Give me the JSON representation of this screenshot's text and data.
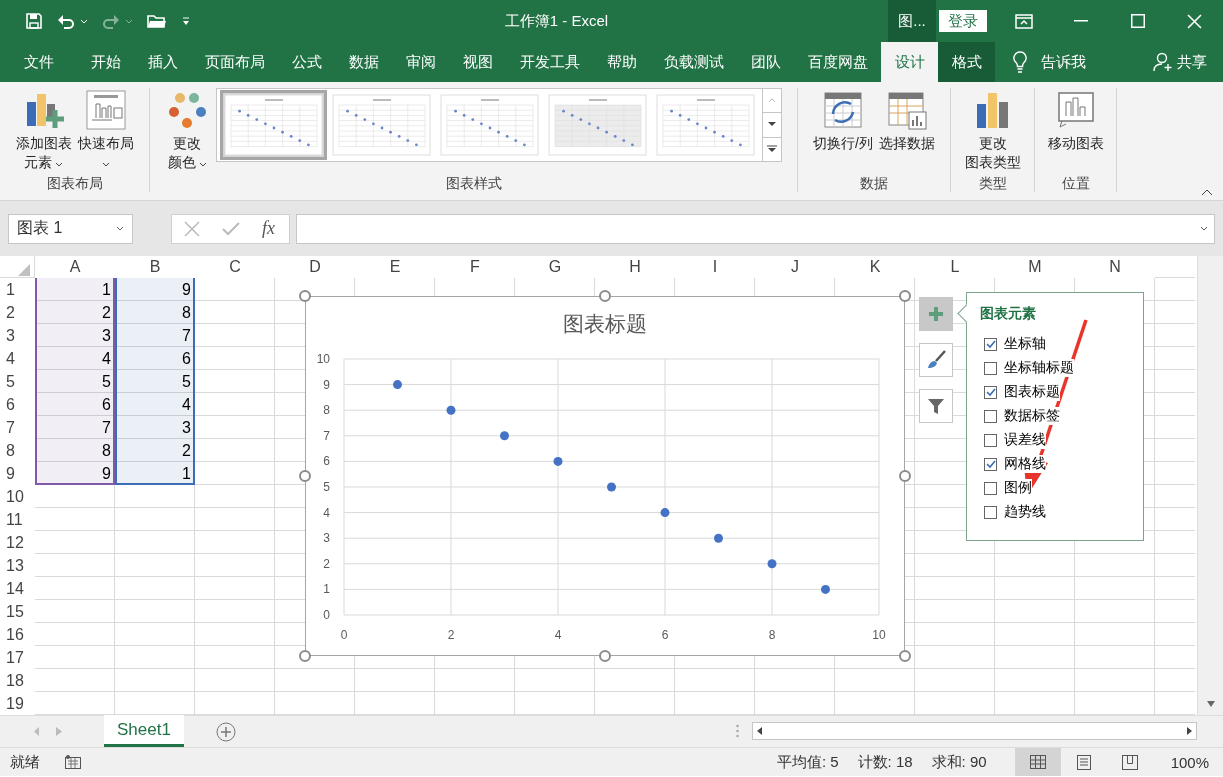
{
  "title_bar": {
    "title": "工作簿1  -  Excel",
    "context_tab": "图...",
    "sign_in": "登录"
  },
  "menu_tabs": [
    {
      "label": "文件",
      "selected": false,
      "kind": "normal"
    },
    {
      "label": "开始",
      "selected": false,
      "kind": "normal"
    },
    {
      "label": "插入",
      "selected": false,
      "kind": "normal"
    },
    {
      "label": "页面布局",
      "selected": false,
      "kind": "normal"
    },
    {
      "label": "公式",
      "selected": false,
      "kind": "normal"
    },
    {
      "label": "数据",
      "selected": false,
      "kind": "normal"
    },
    {
      "label": "审阅",
      "selected": false,
      "kind": "normal"
    },
    {
      "label": "视图",
      "selected": false,
      "kind": "normal"
    },
    {
      "label": "开发工具",
      "selected": false,
      "kind": "normal"
    },
    {
      "label": "帮助",
      "selected": false,
      "kind": "normal"
    },
    {
      "label": "负载测试",
      "selected": false,
      "kind": "normal"
    },
    {
      "label": "团队",
      "selected": false,
      "kind": "normal"
    },
    {
      "label": "百度网盘",
      "selected": false,
      "kind": "normal"
    },
    {
      "label": "设计",
      "selected": true,
      "kind": "contextual"
    },
    {
      "label": "格式",
      "selected": false,
      "kind": "contextual"
    }
  ],
  "tell_me": "告诉我",
  "share": "共享",
  "ribbon": {
    "groups": [
      {
        "label": "图表布局",
        "buttons": [
          {
            "lines": [
              "添加图表",
              "元素"
            ],
            "kind": "elements",
            "dropdown": true
          },
          {
            "lines": [
              "快速布局"
            ],
            "kind": "layout",
            "dropdown": true
          }
        ]
      },
      {
        "label": "图表样式",
        "buttons": [
          {
            "lines": [
              "更改",
              "颜色"
            ],
            "kind": "colors",
            "dropdown": true
          }
        ],
        "gallery": [
          {
            "selected": true,
            "kind": "plain"
          },
          {
            "selected": false,
            "kind": "plain"
          },
          {
            "selected": false,
            "kind": "plain"
          },
          {
            "selected": false,
            "kind": "shaded"
          },
          {
            "selected": false,
            "kind": "plain"
          }
        ]
      },
      {
        "label": "数据",
        "buttons": [
          {
            "lines": [
              "切换行/列"
            ],
            "kind": "switch",
            "dropdown": false
          },
          {
            "lines": [
              "选择数据"
            ],
            "kind": "select",
            "dropdown": false
          }
        ]
      },
      {
        "label": "类型",
        "buttons": [
          {
            "lines": [
              "更改",
              "图表类型"
            ],
            "kind": "type",
            "dropdown": false
          }
        ]
      },
      {
        "label": "位置",
        "buttons": [
          {
            "lines": [
              "移动图表"
            ],
            "kind": "move",
            "dropdown": false
          }
        ]
      }
    ]
  },
  "formula_bar": {
    "name_box": "图表 1",
    "fx": "fx"
  },
  "sheet": {
    "columns": [
      "A",
      "B",
      "C",
      "D",
      "E",
      "F",
      "G",
      "H",
      "I",
      "J",
      "K",
      "L",
      "M",
      "N"
    ],
    "rows": [
      "1",
      "2",
      "3",
      "4",
      "5",
      "6",
      "7",
      "8",
      "9",
      "10",
      "11",
      "12",
      "13",
      "14",
      "15",
      "16",
      "17",
      "18",
      "19"
    ],
    "ranges": [
      {
        "color": "#7e5aa8",
        "values": [
          "1",
          "2",
          "3",
          "4",
          "5",
          "6",
          "7",
          "8",
          "9"
        ]
      },
      {
        "color": "#3b6cb5",
        "values": [
          "9",
          "8",
          "7",
          "6",
          "5",
          "4",
          "3",
          "2",
          "1"
        ]
      }
    ]
  },
  "chart": {
    "chart_data": {
      "type": "scatter",
      "title": "图表标题",
      "x": [
        1,
        2,
        3,
        4,
        5,
        6,
        7,
        8,
        9
      ],
      "grid": true,
      "series": [
        {
          "color": "#4472c4",
          "values": [
            9,
            8,
            7,
            6,
            5,
            4,
            3,
            2,
            1
          ]
        }
      ],
      "xlim": [
        0,
        10
      ],
      "ylim": [
        0,
        10
      ],
      "xticks": [
        0,
        2,
        4,
        6,
        8,
        10
      ],
      "yticks": [
        0,
        1,
        2,
        3,
        4,
        5,
        6,
        7,
        8,
        9,
        10
      ]
    }
  },
  "chart_tools": [
    {
      "kind": "plus",
      "selected": true
    },
    {
      "kind": "brush",
      "selected": false
    },
    {
      "kind": "filter",
      "selected": false
    }
  ],
  "chart_elements": {
    "title": "图表元素",
    "items": [
      {
        "label": "坐标轴",
        "checked": true
      },
      {
        "label": "坐标轴标题",
        "checked": false
      },
      {
        "label": "图表标题",
        "checked": true
      },
      {
        "label": "数据标签",
        "checked": false
      },
      {
        "label": "误差线",
        "checked": false
      },
      {
        "label": "网格线",
        "checked": true
      },
      {
        "label": "图例",
        "checked": false
      },
      {
        "label": "趋势线",
        "checked": false
      }
    ]
  },
  "sheet_tabs": [
    {
      "label": "Sheet1",
      "selected": true
    }
  ],
  "status_bar": {
    "mode": "就绪",
    "stats": [
      "平均值: 5",
      "计数: 18",
      "求和: 90"
    ],
    "views": [
      {
        "kind": "normal",
        "selected": true
      },
      {
        "kind": "layout",
        "selected": false
      },
      {
        "kind": "pagebreak",
        "selected": false
      }
    ],
    "zoom": "100%"
  }
}
